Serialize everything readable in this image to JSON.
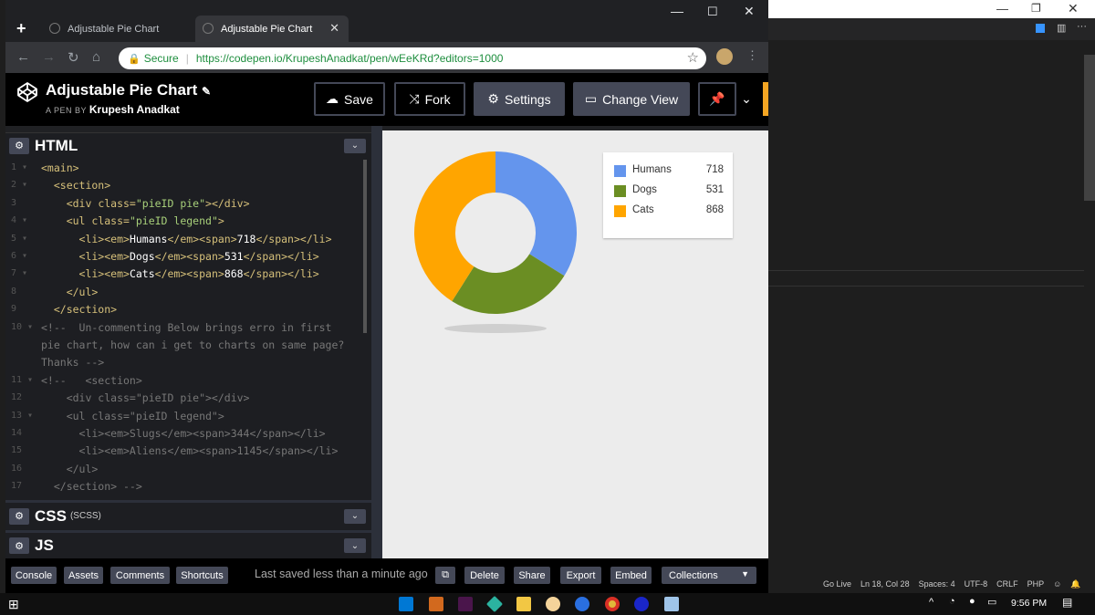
{
  "vscode": {
    "status": [
      "Go Live",
      "Ln 18, Col 28",
      "Spaces: 4",
      "UTF-8",
      "CRLF",
      "PHP"
    ]
  },
  "browser": {
    "tabs": [
      {
        "label": "Adjustable Pie Chart"
      },
      {
        "label": "Adjustable Pie Chart"
      }
    ],
    "secure_label": "Secure",
    "url": "https://codepen.io/KrupeshAnadkat/pen/wEeKRd?editors=1000"
  },
  "codepen": {
    "title": "Adjustable Pie Chart",
    "by_prefix": "A PEN BY",
    "author": "Krupesh Anadkat",
    "buttons": {
      "save": "Save",
      "fork": "Fork",
      "settings": "Settings",
      "change_view": "Change View"
    },
    "editors": {
      "html": "HTML",
      "css": "CSS",
      "css_sub": "(SCSS)",
      "js": "JS"
    },
    "code_lines": [
      {
        "n": "1",
        "fold": true,
        "parts": [
          [
            "tag",
            "<main>"
          ]
        ]
      },
      {
        "n": "2",
        "fold": true,
        "parts": [
          [
            "tag",
            "  <section>"
          ]
        ]
      },
      {
        "n": "3",
        "fold": false,
        "parts": [
          [
            "tag",
            "    <div "
          ],
          [
            "attr",
            "class="
          ],
          [
            "str",
            "\"pieID pie\""
          ],
          [
            "tag",
            "></div>"
          ]
        ]
      },
      {
        "n": "4",
        "fold": true,
        "parts": [
          [
            "tag",
            "    <ul "
          ],
          [
            "attr",
            "class="
          ],
          [
            "str",
            "\"pieID legend\""
          ],
          [
            "tag",
            ">"
          ]
        ]
      },
      {
        "n": "5",
        "fold": true,
        "parts": [
          [
            "tag",
            "      <li><em>"
          ],
          [
            "txt",
            "Humans"
          ],
          [
            "tag",
            "</em><span>"
          ],
          [
            "txt",
            "718"
          ],
          [
            "tag",
            "</span></li>"
          ]
        ]
      },
      {
        "n": "6",
        "fold": true,
        "parts": [
          [
            "tag",
            "      <li><em>"
          ],
          [
            "txt",
            "Dogs"
          ],
          [
            "tag",
            "</em><span>"
          ],
          [
            "txt",
            "531"
          ],
          [
            "tag",
            "</span></li>"
          ]
        ]
      },
      {
        "n": "7",
        "fold": true,
        "parts": [
          [
            "tag",
            "      <li><em>"
          ],
          [
            "txt",
            "Cats"
          ],
          [
            "tag",
            "</em><span>"
          ],
          [
            "txt",
            "868"
          ],
          [
            "tag",
            "</span></li>"
          ]
        ]
      },
      {
        "n": "8",
        "fold": false,
        "parts": [
          [
            "tag",
            "    </ul>"
          ]
        ]
      },
      {
        "n": "9",
        "fold": false,
        "parts": [
          [
            "tag",
            "  </section>"
          ]
        ]
      },
      {
        "n": "10",
        "fold": true,
        "parts": [
          [
            "cmt",
            "<!--  Un-commenting Below brings erro in first"
          ]
        ]
      },
      {
        "n": "",
        "fold": false,
        "parts": [
          [
            "cmt",
            "pie chart, how can i get to charts on same page?"
          ]
        ]
      },
      {
        "n": "",
        "fold": false,
        "parts": [
          [
            "cmt",
            "Thanks -->"
          ]
        ]
      },
      {
        "n": "11",
        "fold": true,
        "parts": [
          [
            "cmt",
            "<!--   <section>"
          ]
        ]
      },
      {
        "n": "12",
        "fold": false,
        "parts": [
          [
            "cmt",
            "    <div class=\"pieID pie\"></div>"
          ]
        ]
      },
      {
        "n": "13",
        "fold": true,
        "parts": [
          [
            "cmt",
            "    <ul class=\"pieID legend\">"
          ]
        ]
      },
      {
        "n": "14",
        "fold": false,
        "parts": [
          [
            "cmt",
            "      <li><em>Slugs</em><span>344</span></li>"
          ]
        ]
      },
      {
        "n": "15",
        "fold": false,
        "parts": [
          [
            "cmt",
            "      <li><em>Aliens</em><span>1145</span></li>"
          ]
        ]
      },
      {
        "n": "16",
        "fold": false,
        "parts": [
          [
            "cmt",
            "    </ul>"
          ]
        ]
      },
      {
        "n": "17",
        "fold": false,
        "parts": [
          [
            "cmt",
            "  </section> -->"
          ]
        ]
      }
    ],
    "footer": {
      "console": "Console",
      "assets": "Assets",
      "comments": "Comments",
      "shortcuts": "Shortcuts",
      "saved": "Last saved less than a minute ago",
      "delete": "Delete",
      "share": "Share",
      "export": "Export",
      "embed": "Embed",
      "collections": "Collections"
    }
  },
  "chart_data": {
    "type": "pie",
    "donut": true,
    "categories": [
      "Humans",
      "Dogs",
      "Cats"
    ],
    "values": [
      718,
      531,
      868
    ],
    "colors": [
      "#6495ed",
      "#6b8e23",
      "#ffa500"
    ]
  },
  "taskbar": {
    "time": "9:56 PM"
  }
}
